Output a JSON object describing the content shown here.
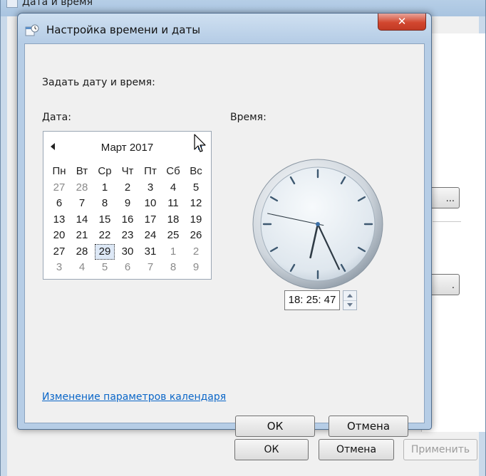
{
  "parent_window": {
    "title": "Дата и время",
    "side_buttons": [
      "...",
      "."
    ],
    "buttons": {
      "ok": "ОК",
      "cancel": "Отмена",
      "apply": "Применить"
    }
  },
  "dialog": {
    "title": "Настройка времени и даты",
    "close_label": "✕",
    "set_label": "Задать дату и время:",
    "date_label": "Дата:",
    "time_label": "Время:",
    "calendar": {
      "month_label": "Март 2017",
      "weekdays": [
        "Пн",
        "Вт",
        "Ср",
        "Чт",
        "Пт",
        "Сб",
        "Вс"
      ],
      "weeks": [
        [
          {
            "d": "27",
            "o": true
          },
          {
            "d": "28",
            "o": true
          },
          {
            "d": "1"
          },
          {
            "d": "2"
          },
          {
            "d": "3"
          },
          {
            "d": "4"
          },
          {
            "d": "5"
          }
        ],
        [
          {
            "d": "6"
          },
          {
            "d": "7"
          },
          {
            "d": "8"
          },
          {
            "d": "9"
          },
          {
            "d": "10"
          },
          {
            "d": "11"
          },
          {
            "d": "12"
          }
        ],
        [
          {
            "d": "13"
          },
          {
            "d": "14"
          },
          {
            "d": "15"
          },
          {
            "d": "16"
          },
          {
            "d": "17"
          },
          {
            "d": "18"
          },
          {
            "d": "19"
          }
        ],
        [
          {
            "d": "20"
          },
          {
            "d": "21"
          },
          {
            "d": "22"
          },
          {
            "d": "23"
          },
          {
            "d": "24"
          },
          {
            "d": "25"
          },
          {
            "d": "26"
          }
        ],
        [
          {
            "d": "27"
          },
          {
            "d": "28"
          },
          {
            "d": "29",
            "s": true
          },
          {
            "d": "30"
          },
          {
            "d": "31"
          },
          {
            "d": "1",
            "o": true
          },
          {
            "d": "2",
            "o": true
          }
        ],
        [
          {
            "d": "3",
            "o": true
          },
          {
            "d": "4",
            "o": true
          },
          {
            "d": "5",
            "o": true
          },
          {
            "d": "6",
            "o": true
          },
          {
            "d": "7",
            "o": true
          },
          {
            "d": "8",
            "o": true
          },
          {
            "d": "9",
            "o": true
          }
        ]
      ],
      "selected_day": "29"
    },
    "clock": {
      "hours": 18,
      "minutes": 25,
      "seconds": 47
    },
    "time_value": "18: 25: 47",
    "calendar_link": "Изменение параметров календаря",
    "buttons": {
      "ok": "ОК",
      "cancel": "Отмена"
    }
  },
  "colors": {
    "link": "#0a66c8",
    "close_button": "#d2472f",
    "title_bar": "#b6cde6"
  },
  "icons": {
    "dialog_icon": "clock-calendar-icon",
    "prev_month": "triangle-left-icon",
    "next_month": "triangle-right-icon",
    "spin_up": "triangle-up-icon",
    "spin_down": "triangle-down-icon",
    "cursor": "mouse-pointer-icon"
  }
}
